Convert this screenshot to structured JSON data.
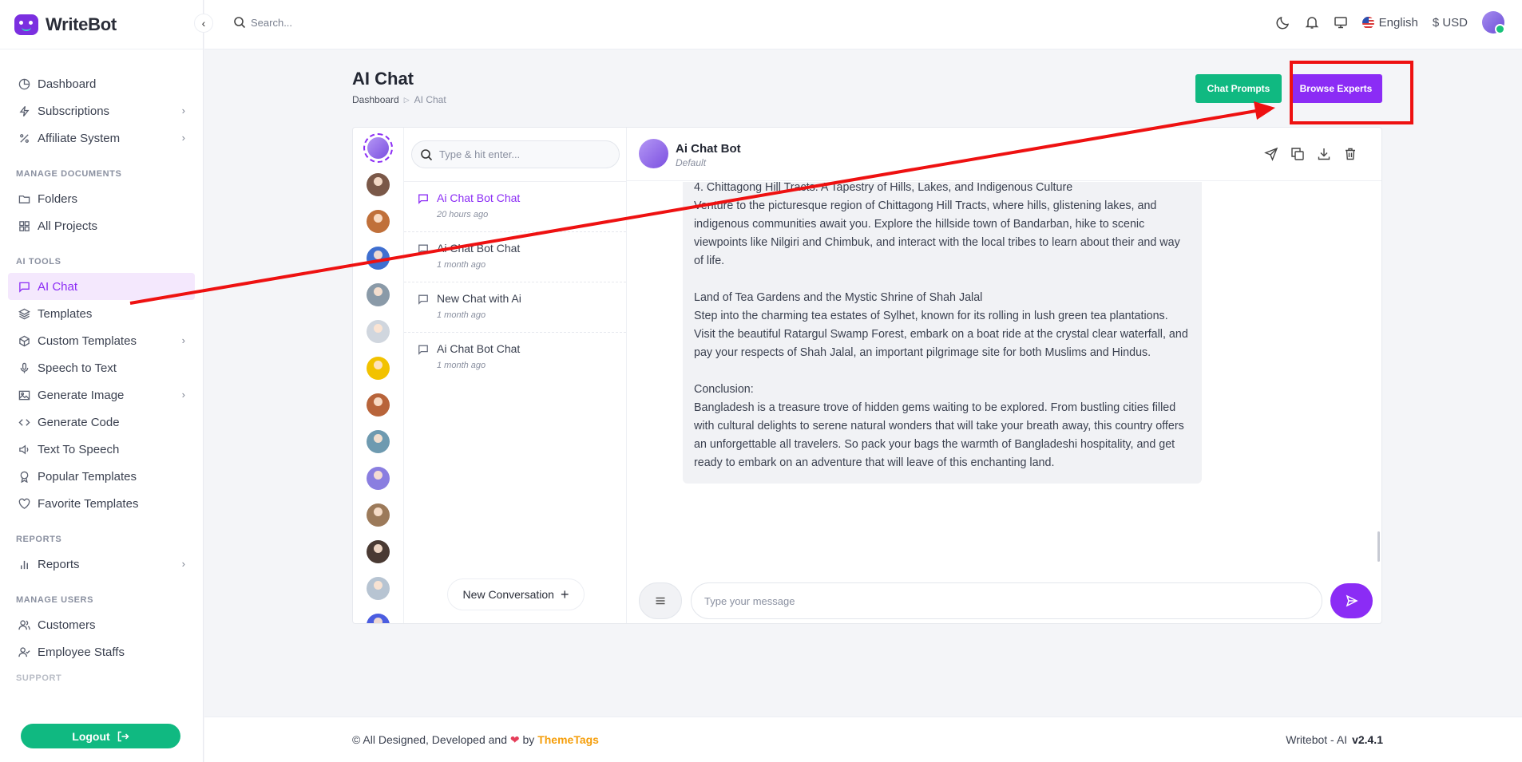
{
  "app": {
    "name": "WriteBot"
  },
  "topbar": {
    "search_placeholder": "Search...",
    "language": "English",
    "currency": "$ USD"
  },
  "sidebar": {
    "items_top": [
      {
        "label": "Dashboard"
      },
      {
        "label": "Subscriptions"
      },
      {
        "label": "Affiliate System"
      }
    ],
    "section_docs": "MANAGE DOCUMENTS",
    "items_docs": [
      {
        "label": "Folders"
      },
      {
        "label": "All Projects"
      }
    ],
    "section_ai": "AI TOOLS",
    "items_ai": [
      {
        "label": "AI Chat"
      },
      {
        "label": "Templates"
      },
      {
        "label": "Custom Templates"
      },
      {
        "label": "Speech to Text"
      },
      {
        "label": "Generate Image"
      },
      {
        "label": "Generate Code"
      },
      {
        "label": "Text To Speech"
      },
      {
        "label": "Popular Templates"
      },
      {
        "label": "Favorite Templates"
      }
    ],
    "section_reports": "REPORTS",
    "items_reports": [
      {
        "label": "Reports"
      }
    ],
    "section_users": "MANAGE USERS",
    "items_users": [
      {
        "label": "Customers"
      },
      {
        "label": "Employee Staffs"
      }
    ],
    "section_support": "SUPPORT",
    "logout_label": "Logout"
  },
  "page": {
    "title": "AI Chat",
    "breadcrumb": {
      "root": "Dashboard",
      "current": "AI Chat"
    },
    "chat_prompts_label": "Chat Prompts",
    "browse_experts_label": "Browse Experts"
  },
  "conversations": {
    "search_placeholder": "Type & hit enter...",
    "items": [
      {
        "title": "Ai Chat Bot Chat",
        "time": "20 hours ago"
      },
      {
        "title": "Ai Chat Bot Chat",
        "time": "1 month ago"
      },
      {
        "title": "New Chat with Ai",
        "time": "1 month ago"
      },
      {
        "title": "Ai Chat Bot Chat",
        "time": "1 month ago"
      }
    ],
    "new_label": "New Conversation"
  },
  "chat": {
    "bot_name": "Ai Chat Bot",
    "bot_sub": "Default",
    "paragraphs": [
      "4. Chittagong Hill Tracts: A Tapestry of Hills, Lakes, and Indigenous Culture\nVenture to the picturesque region of Chittagong Hill Tracts, where hills, glistening lakes, and indigenous communities await you. Explore the hillside town of Bandarban, hike to scenic viewpoints like Nilgiri and Chimbuk, and interact with the local tribes to learn about their and way of life.",
      "Land of Tea Gardens and the Mystic Shrine of Shah Jalal\nStep into the charming tea estates of Sylhet, known for its rolling in lush green tea plantations. Visit the beautiful Ratargul Swamp Forest, embark on a boat ride at the crystal clear waterfall, and pay your respects of Shah Jalal, an important pilgrimage site for both Muslims and Hindus.",
      "Conclusion:\nBangladesh is a treasure trove of hidden gems waiting to be explored. From bustling cities filled with cultural delights to serene natural wonders that will take your breath away, this country offers an unforgettable all travelers. So pack your bags the warmth of Bangladeshi hospitality, and get ready to embark on an adventure that will leave of this enchanting land."
    ],
    "input_placeholder": "Type your message"
  },
  "footer": {
    "left_text": "© All Designed, Developed and",
    "by": "by",
    "brand": "ThemeTags",
    "right_text": "Writebot - AI",
    "version": "v2.4.1"
  },
  "colors": {
    "accent": "#8b2cf5",
    "green": "#10b981",
    "annotation": "#ee1111"
  },
  "experts_avatar_colors": [
    "#7a5848",
    "#c0703a",
    "#3f6fd0",
    "#8a9aa8",
    "#d0d6de",
    "#f2c200",
    "#b8643a",
    "#6e9ab0",
    "#8a7ee0",
    "#9c7a5a",
    "#4a3a33",
    "#b7c4d2",
    "#4b5de0"
  ]
}
